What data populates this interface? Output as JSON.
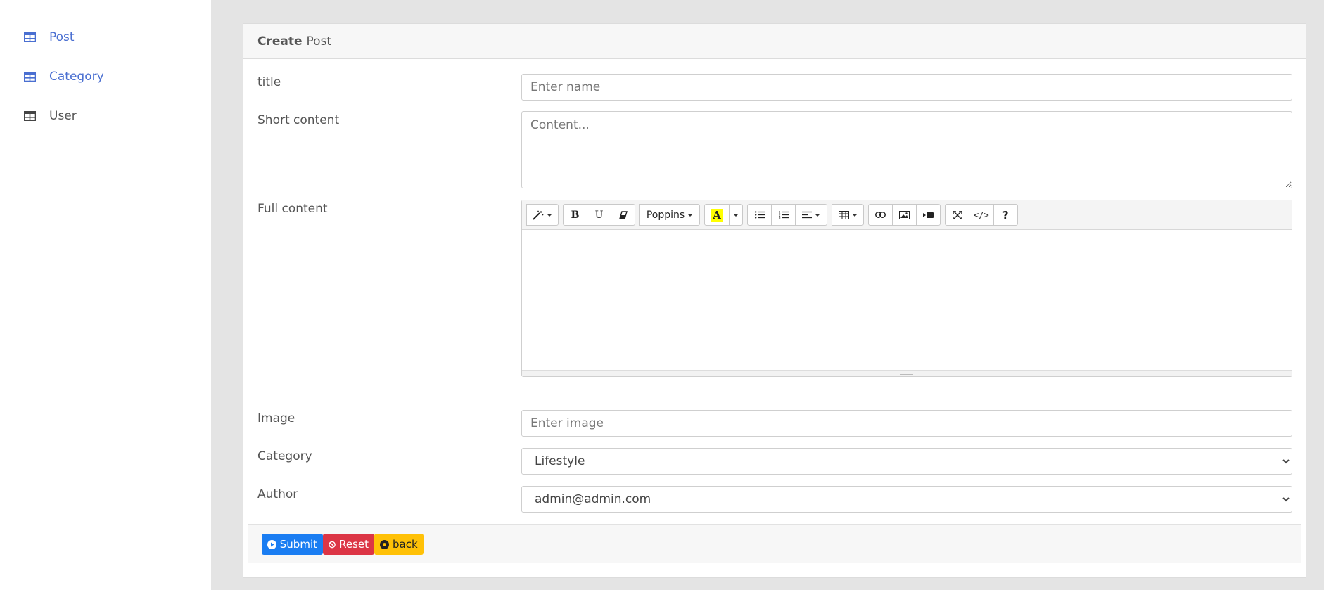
{
  "sidebar": {
    "items": [
      {
        "label": "Post",
        "icon": "table-icon"
      },
      {
        "label": "Category",
        "icon": "table-icon"
      },
      {
        "label": "User",
        "icon": "table-icon"
      }
    ]
  },
  "card": {
    "header_bold": "Create",
    "header_rest": "Post"
  },
  "form": {
    "title_label": "title",
    "title_placeholder": "Enter name",
    "short_label": "Short content",
    "short_placeholder": "Content...",
    "full_label": "Full content",
    "image_label": "Image",
    "image_placeholder": "Enter image",
    "category_label": "Category",
    "category_value": "Lifestyle",
    "author_label": "Author",
    "author_value": "admin@admin.com"
  },
  "editor": {
    "font_name": "Poppins",
    "bold": "B",
    "underline": "U",
    "color_a": "A",
    "help": "?",
    "code": "</>"
  },
  "buttons": {
    "submit": "Submit",
    "reset": "Reset",
    "back": "back"
  },
  "colors": {
    "primary": "#1a7df2",
    "danger": "#dc3545",
    "warning": "#ffc107",
    "link": "#4a6fd1"
  }
}
